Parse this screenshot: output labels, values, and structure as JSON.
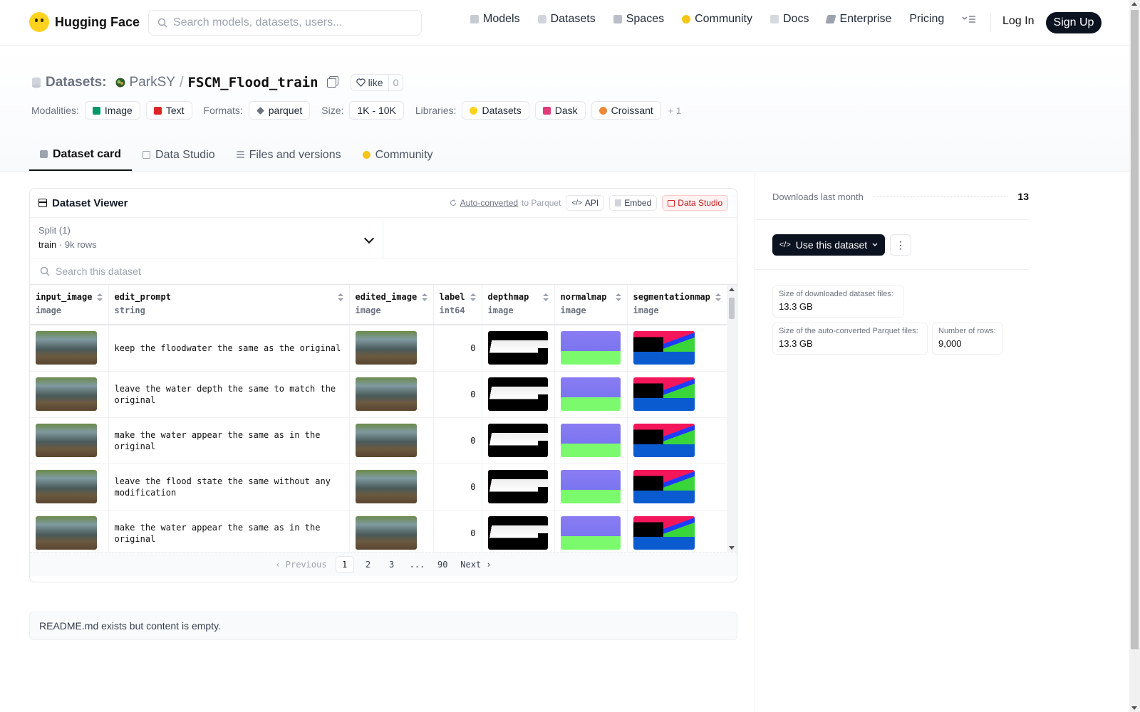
{
  "header": {
    "brand": "Hugging Face",
    "search_placeholder": "Search models, datasets, users...",
    "nav": [
      "Models",
      "Datasets",
      "Spaces",
      "Community",
      "Docs",
      "Enterprise",
      "Pricing"
    ],
    "login": "Log In",
    "signup": "Sign Up"
  },
  "title": {
    "section": "Datasets:",
    "owner": "ParkSY",
    "separator": "/",
    "name": "FSCM_Flood_train",
    "like_label": "like",
    "like_count": "0"
  },
  "tags": {
    "modalities_label": "Modalities:",
    "modalities": [
      "Image",
      "Text"
    ],
    "formats_label": "Formats:",
    "formats": [
      "parquet"
    ],
    "size_label": "Size:",
    "size": "1K - 10K",
    "libraries_label": "Libraries:",
    "libraries": [
      "Datasets",
      "Dask",
      "Croissant"
    ],
    "more": "+ 1"
  },
  "tabs": [
    "Dataset card",
    "Data Studio",
    "Files and versions",
    "Community"
  ],
  "viewer": {
    "title": "Dataset Viewer",
    "autoconverted": "Auto-converted",
    "to_parquet": "to Parquet",
    "api": "API",
    "embed": "Embed",
    "data_studio": "Data Studio",
    "split_label": "Split (1)",
    "split_name": "train",
    "split_rows": "9k rows",
    "search_placeholder": "Search this dataset",
    "columns": [
      {
        "name": "input_image",
        "type": "image"
      },
      {
        "name": "edit_prompt",
        "type": "string"
      },
      {
        "name": "edited_image",
        "type": "image"
      },
      {
        "name": "label",
        "type": "int64"
      },
      {
        "name": "depthmap",
        "type": "image"
      },
      {
        "name": "normalmap",
        "type": "image"
      },
      {
        "name": "segmentationmap",
        "type": "image"
      }
    ],
    "rows": [
      {
        "edit_prompt": "keep the floodwater the same as the original",
        "label": "0"
      },
      {
        "edit_prompt": "leave the water depth the same to match the original",
        "label": "0"
      },
      {
        "edit_prompt": "make the water appear the same as in the original",
        "label": "0"
      },
      {
        "edit_prompt": "leave the flood state the same without any modification",
        "label": "0"
      },
      {
        "edit_prompt": "make the water appear the same as in the original",
        "label": "0"
      }
    ],
    "pager": {
      "prev": "Previous",
      "pages": [
        "1",
        "2",
        "3",
        "...",
        "90"
      ],
      "next": "Next"
    }
  },
  "readme": "README.md exists but content is empty.",
  "sidebar": {
    "downloads_label": "Downloads last month",
    "downloads_value": "13",
    "use_dataset": "Use this dataset",
    "stats": [
      {
        "label": "Size of downloaded dataset files:",
        "value": "13.3 GB"
      },
      {
        "label": "Size of the auto-converted Parquet files:",
        "value": "13.3 GB"
      },
      {
        "label": "Number of rows:",
        "value": "9,000"
      }
    ]
  },
  "colors": {
    "accent_dark": "#0b1220",
    "like_border": "#e5e7eb",
    "data_studio_red": "#b91c1c"
  }
}
